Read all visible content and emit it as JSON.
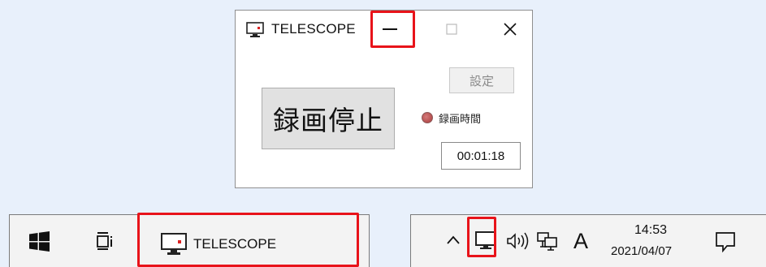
{
  "window": {
    "title": "TELESCOPE",
    "record_button": "録画停止",
    "settings_button": "設定",
    "recording_label": "録画時間",
    "elapsed": "00:01:18",
    "caption_buttons": {
      "minimize": "—",
      "maximize": "□",
      "close": "✕"
    }
  },
  "taskbar": {
    "app_label": "TELESCOPE",
    "ime_indicator": "A",
    "clock": {
      "time": "14:53",
      "date": "2021/04/07"
    },
    "icons": [
      "windows-start-icon",
      "task-view-icon",
      "monitor-icon",
      "chevron-up-icon",
      "volume-icon",
      "network-icon",
      "notification-icon"
    ]
  },
  "colors": {
    "highlight": "#e8131a",
    "record_dot": "#b04444",
    "desktop_background": "#e8f0fb"
  }
}
